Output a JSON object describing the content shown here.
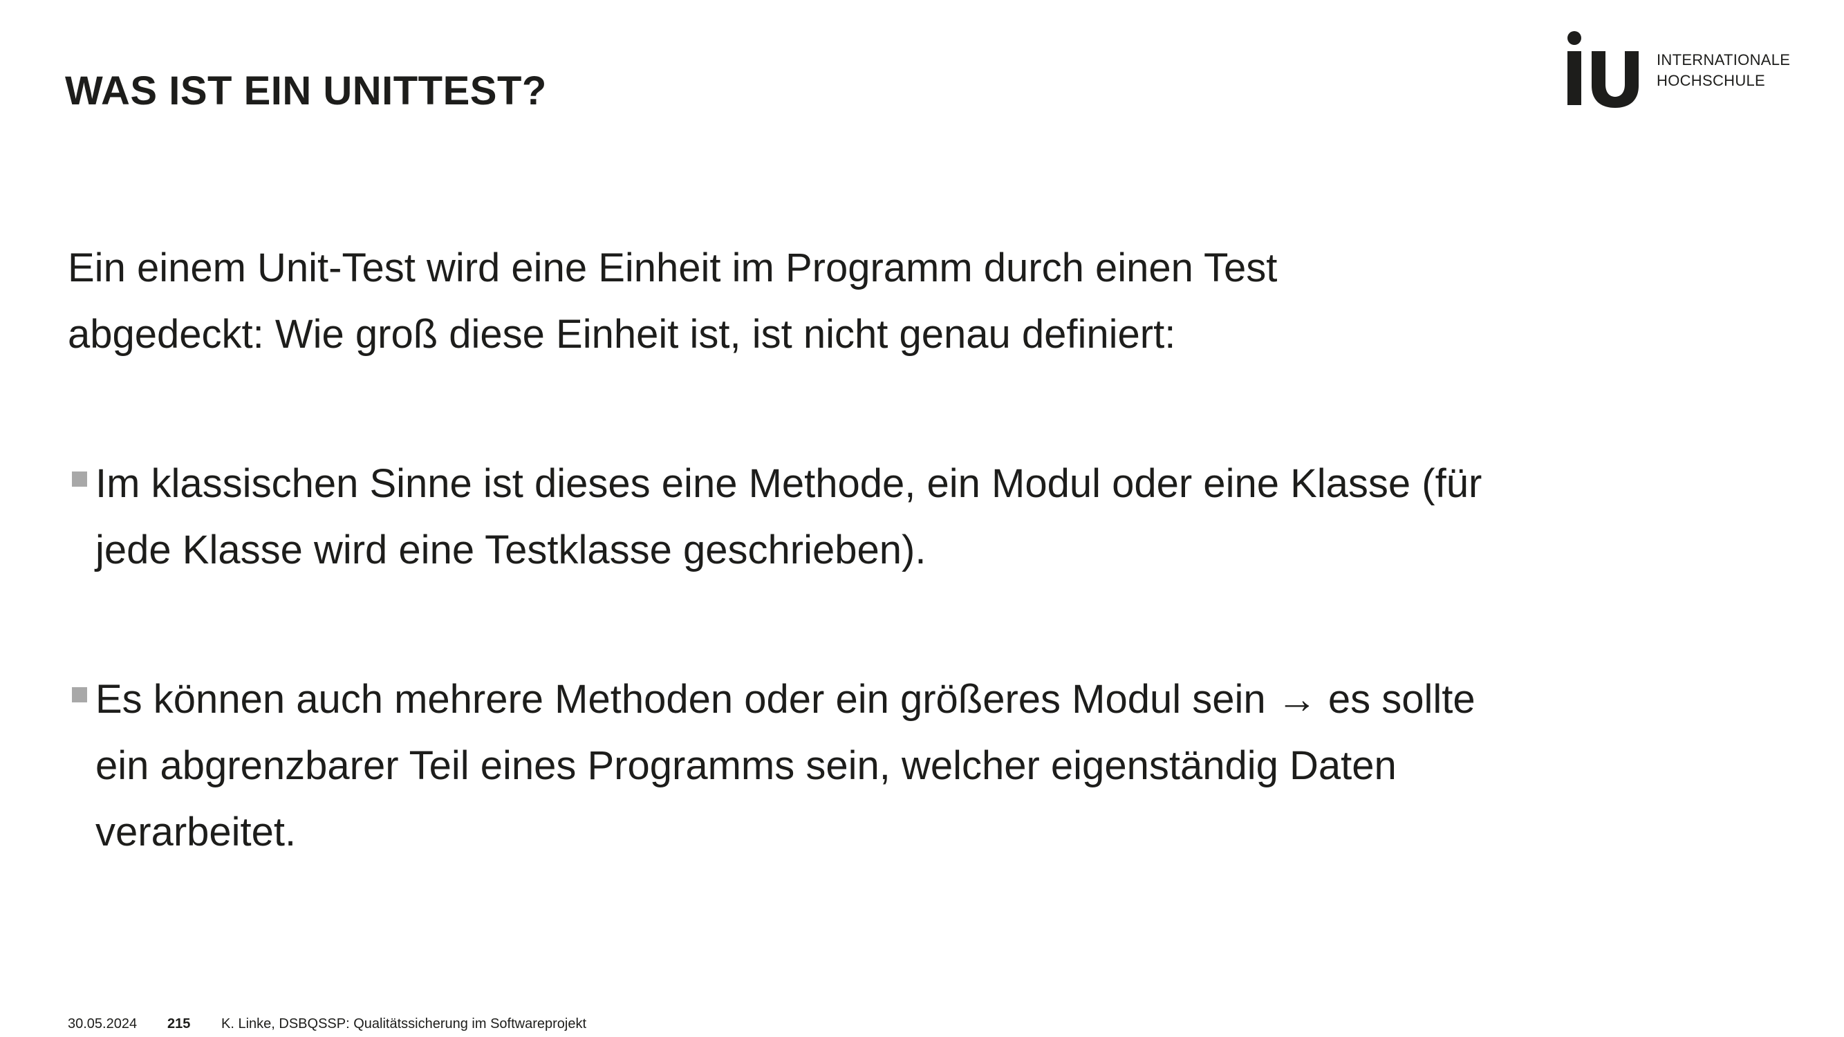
{
  "slide": {
    "title": "WAS IST EIN UNITTEST?",
    "intro_line1": "Ein einem Unit-Test wird eine Einheit im Programm durch einen Test",
    "intro_line2": "abgedeckt: Wie groß diese Einheit ist, ist nicht genau definiert:",
    "bullets": [
      {
        "lines": [
          "Im klassischen Sinne ist dieses eine Methode, ein Modul oder eine Klasse (für",
          "jede Klasse wird eine Testklasse geschrieben)."
        ]
      },
      {
        "lines": [
          "Es können auch mehrere Methoden oder ein größeres Modul sein → es sollte",
          "ein abgrenzbarer Teil eines Programms sein, welcher eigenständig Daten",
          "verarbeitet."
        ]
      }
    ]
  },
  "logo": {
    "mark": "iu",
    "line1": "INTERNATIONALE",
    "line2": "HOCHSCHULE"
  },
  "footer": {
    "date": "30.05.2024",
    "page_number": "215",
    "author": "K. Linke, ",
    "course": "DSBQSSP: Qualitätssicherung im Softwareprojekt"
  },
  "colors": {
    "text": "#1d1d1b",
    "bullet_marker": "#a8a8a8",
    "background": "#ffffff"
  }
}
